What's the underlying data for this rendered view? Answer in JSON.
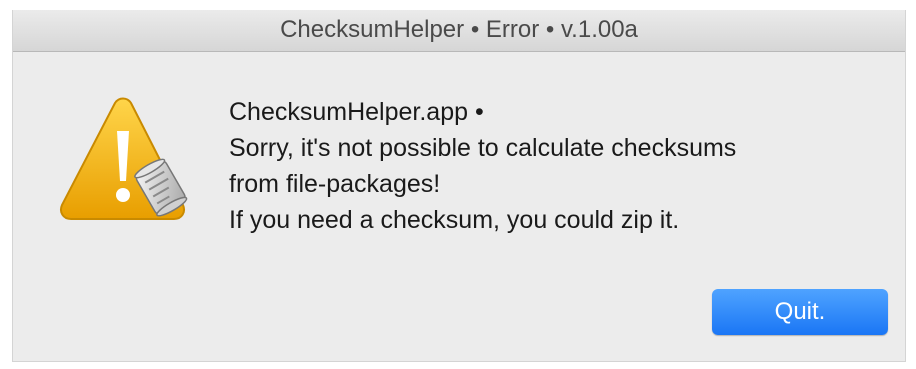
{
  "window": {
    "title": "ChecksumHelper • Error • v.1.00a"
  },
  "alert": {
    "icon": "warning-triangle-script-icon",
    "app_line": "ChecksumHelper.app •",
    "lines": [
      "Sorry, it's not possible to calculate checksums",
      "from file-packages!",
      "If you need a checksum, you could zip it."
    ]
  },
  "buttons": {
    "quit_label": "Quit."
  },
  "colors": {
    "accent": "#1a76f5",
    "warning": "#f0b400"
  }
}
